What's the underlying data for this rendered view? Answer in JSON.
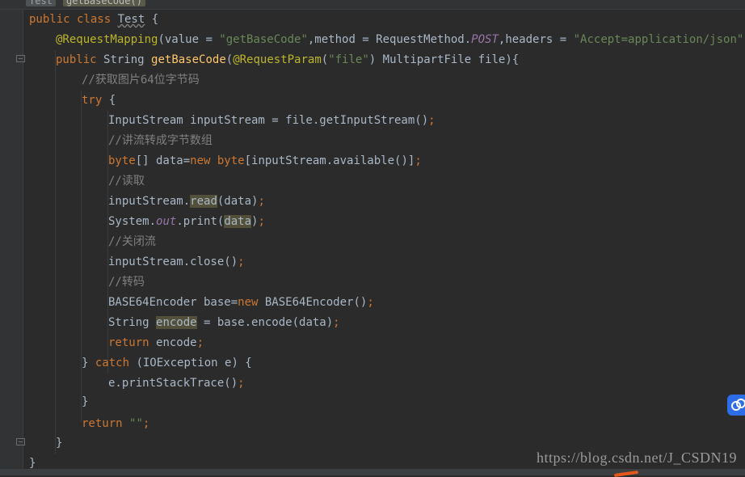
{
  "breadcrumb": {
    "items": [
      "Test",
      "getBaseCode()"
    ]
  },
  "watermark": "https://blog.csdn.net/J_CSDN19",
  "code": {
    "l1_kw": "public class ",
    "l1_class": "Test",
    "l1_rest": " {",
    "l2_ann": "@RequestMapping",
    "l2_a": "(value = ",
    "l2_s1": "\"getBaseCode\"",
    "l2_b": ",method = RequestMethod.",
    "l2_field": "POST",
    "l2_c": ",headers = ",
    "l2_s2": "\"Accept=application/json\"",
    "l2_d": ")",
    "l3_kw": "public ",
    "l3_a": "String ",
    "l3_fn": "getBaseCode",
    "l3_b": "(",
    "l3_ann": "@RequestParam",
    "l3_c": "(",
    "l3_s": "\"file\"",
    "l3_d": ") MultipartFile file){",
    "l4_cm": "//获取图片64位字节码",
    "l5_kw": "try",
    "l5_a": " {",
    "l6_a": "InputStream inputStream = file.getInputStream()",
    "l6_semi": ";",
    "l7_cm": "//讲流转成字节数组",
    "l8_kw1": "byte",
    "l8_a": "[] data=",
    "l8_kw2": "new ",
    "l8_kw3": "byte",
    "l8_b": "[inputStream.available()]",
    "l8_semi": ";",
    "l9_cm": "//读取",
    "l10_a": "inputStream.",
    "l10_hl": "read",
    "l10_b": "(data)",
    "l10_semi": ";",
    "l11_a": "System.",
    "l11_field": "out",
    "l11_b": ".print(",
    "l11_hl": "data",
    "l11_c": ")",
    "l11_semi": ";",
    "l12_cm": "//关闭流",
    "l13_a": "inputStream.close()",
    "l13_semi": ";",
    "l14_cm": "//转码",
    "l15_a": "BASE64Encoder base=",
    "l15_kw": "new ",
    "l15_b": "BASE64Encoder()",
    "l15_semi": ";",
    "l16_a": "String ",
    "l16_hl": "encode",
    "l16_b": " = base.encode(data)",
    "l16_semi": ";",
    "l17_kw": "return ",
    "l17_a": "encode",
    "l17_semi": ";",
    "l18_a": "} ",
    "l18_kw": "catch ",
    "l18_b": "(IOException e) {",
    "l19_a": "e.printStackTrace()",
    "l19_semi": ";",
    "l20_a": "}",
    "l21_kw": "return ",
    "l21_s": "\"\"",
    "l21_semi": ";",
    "l22_a": "}",
    "l23_a": "}"
  }
}
